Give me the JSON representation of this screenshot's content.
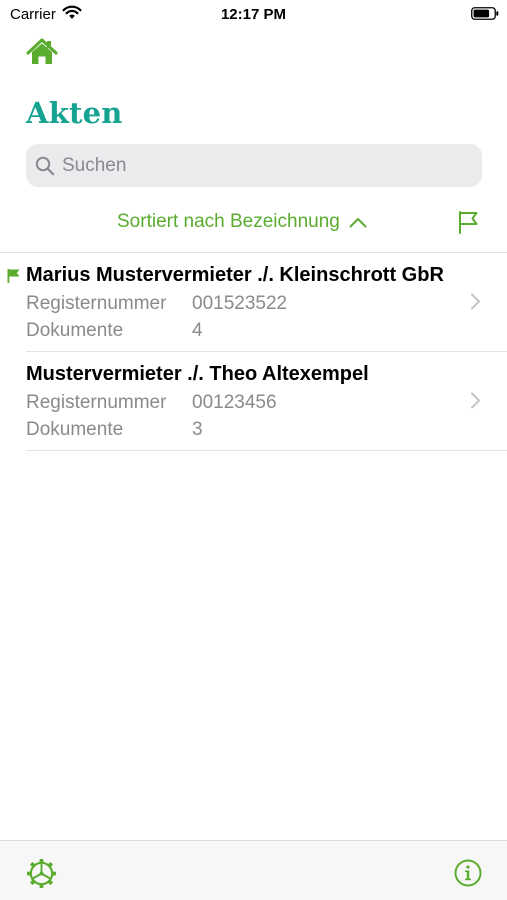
{
  "status_bar": {
    "carrier": "Carrier",
    "time": "12:17 PM"
  },
  "header": {
    "title": "Akten"
  },
  "search": {
    "placeholder": "Suchen",
    "value": ""
  },
  "sort": {
    "label": "Sortiert nach Bezeichnung"
  },
  "colors": {
    "accent_green": "#5aac2e",
    "title_teal": "#16a391",
    "secondary_text": "#8a8a8e"
  },
  "icons": {
    "home": "home-icon",
    "search": "search-icon",
    "sort_direction": "chevron-up-icon",
    "flag_filter": "flag-icon",
    "row_flag": "flag-icon",
    "disclosure": "chevron-right-icon",
    "settings": "gear-icon",
    "info": "info-icon"
  },
  "list": {
    "items": [
      {
        "title": "Marius Mustervermieter ./. Kleinschrott GbR",
        "flagged": true,
        "registernummer_label": "Registernummer",
        "registernummer": "001523522",
        "dokumente_label": "Dokumente",
        "dokumente": "4"
      },
      {
        "title": "Mustervermieter ./. Theo Altexempel",
        "flagged": false,
        "registernummer_label": "Registernummer",
        "registernummer": "00123456",
        "dokumente_label": "Dokumente",
        "dokumente": "3"
      }
    ]
  }
}
